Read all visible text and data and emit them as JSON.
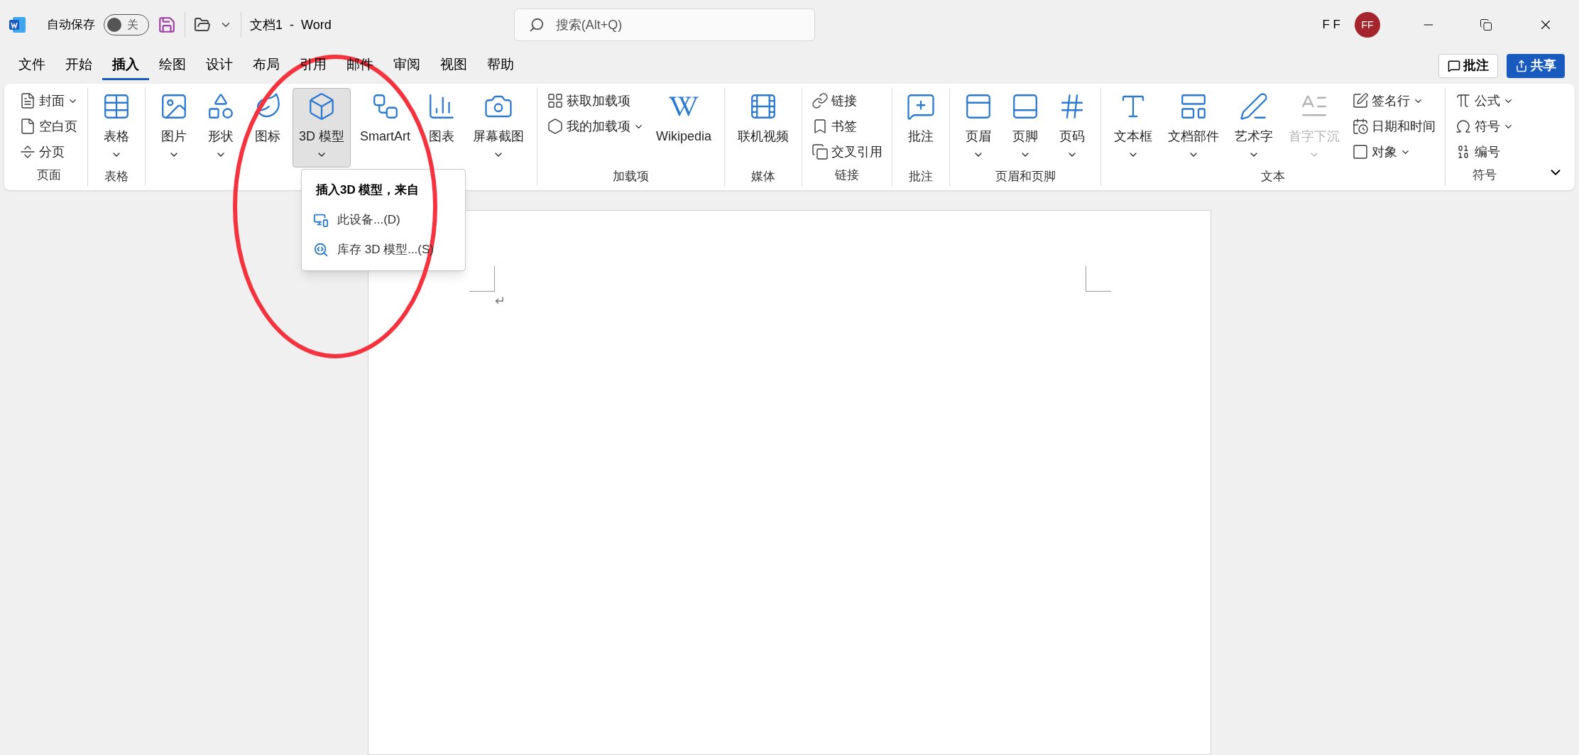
{
  "title_bar": {
    "autosave_label": "自动保存",
    "autosave_toggle": {
      "on": false,
      "label": "关"
    },
    "title": "文档1  -  Word",
    "search": {
      "placeholder": "搜索(Alt+Q)"
    },
    "user_name": "F F",
    "avatar": "FF"
  },
  "menu_tabs": [
    {
      "label": "文件",
      "selected": false
    },
    {
      "label": "开始",
      "selected": false
    },
    {
      "label": "插入",
      "selected": true
    },
    {
      "label": "绘图",
      "selected": false
    },
    {
      "label": "设计",
      "selected": false
    },
    {
      "label": "布局",
      "selected": false
    },
    {
      "label": "引用",
      "selected": false
    },
    {
      "label": "邮件",
      "selected": false
    },
    {
      "label": "审阅",
      "selected": false
    },
    {
      "label": "视图",
      "selected": false
    },
    {
      "label": "帮助",
      "selected": false
    }
  ],
  "comments_button": "批注",
  "share_button": "共享",
  "ribbon_groups": [
    {
      "label": "页面",
      "items": [
        {
          "label": "封面",
          "kind": "small",
          "dropdown": true,
          "disabled": false,
          "expanded": false
        },
        {
          "label": "空白页",
          "kind": "small",
          "dropdown": false,
          "disabled": false,
          "expanded": false
        },
        {
          "label": "分页",
          "kind": "small",
          "dropdown": false,
          "disabled": false,
          "expanded": false
        }
      ]
    },
    {
      "label": "表格",
      "items": [
        {
          "label": "表格",
          "kind": "large",
          "dropdown": true,
          "disabled": false,
          "expanded": false
        }
      ]
    },
    {
      "items": [
        {
          "label": "图片",
          "kind": "large",
          "dropdown": true,
          "disabled": false,
          "expanded": false
        },
        {
          "label": "形状",
          "kind": "large",
          "dropdown": true,
          "disabled": false,
          "expanded": false
        },
        {
          "label": "图标",
          "kind": "large",
          "dropdown": false,
          "disabled": false,
          "expanded": false
        },
        {
          "label": "3D 模型",
          "kind": "large",
          "dropdown": true,
          "disabled": false,
          "expanded": true
        },
        {
          "label": "SmartArt",
          "kind": "large",
          "dropdown": false,
          "disabled": false,
          "expanded": false
        },
        {
          "label": "图表",
          "kind": "large",
          "dropdown": false,
          "disabled": false,
          "expanded": false
        },
        {
          "label": "屏幕截图",
          "kind": "large",
          "dropdown": true,
          "disabled": false,
          "expanded": false
        }
      ]
    },
    {
      "label": "加载项",
      "items": [
        {
          "label": "获取加载项",
          "kind": "small",
          "dropdown": false,
          "disabled": false,
          "expanded": false
        },
        {
          "label": "我的加载项",
          "kind": "small",
          "dropdown": true,
          "disabled": false,
          "expanded": false
        },
        {
          "label": "Wikipedia",
          "kind": "large",
          "dropdown": false,
          "disabled": false,
          "expanded": false
        }
      ]
    },
    {
      "label": "媒体",
      "items": [
        {
          "label": "联机视频",
          "kind": "large",
          "dropdown": false,
          "disabled": false,
          "expanded": false
        }
      ]
    },
    {
      "label": "链接",
      "items": [
        {
          "label": "链接",
          "kind": "small",
          "dropdown": false,
          "disabled": false,
          "expanded": false
        },
        {
          "label": "书签",
          "kind": "small",
          "dropdown": false,
          "disabled": false,
          "expanded": false
        },
        {
          "label": "交叉引用",
          "kind": "small",
          "dropdown": false,
          "disabled": false,
          "expanded": false
        }
      ]
    },
    {
      "label": "批注",
      "items": [
        {
          "label": "批注",
          "kind": "large",
          "dropdown": false,
          "disabled": false,
          "expanded": false
        }
      ]
    },
    {
      "label": "页眉和页脚",
      "items": [
        {
          "label": "页眉",
          "kind": "large",
          "dropdown": true,
          "disabled": false,
          "expanded": false
        },
        {
          "label": "页脚",
          "kind": "large",
          "dropdown": true,
          "disabled": false,
          "expanded": false
        },
        {
          "label": "页码",
          "kind": "large",
          "dropdown": true,
          "disabled": false,
          "expanded": false
        }
      ]
    },
    {
      "label": "文本",
      "items": [
        {
          "label": "文本框",
          "kind": "large",
          "dropdown": true,
          "disabled": false,
          "expanded": false
        },
        {
          "label": "文档部件",
          "kind": "large",
          "dropdown": true,
          "disabled": false,
          "expanded": false
        },
        {
          "label": "艺术字",
          "kind": "large",
          "dropdown": true,
          "disabled": false,
          "expanded": false
        },
        {
          "label": "首字下沉",
          "kind": "large",
          "dropdown": true,
          "disabled": true,
          "expanded": false
        },
        {
          "label": "签名行",
          "kind": "small",
          "dropdown": true,
          "disabled": false,
          "expanded": false
        },
        {
          "label": "日期和时间",
          "kind": "small",
          "dropdown": false,
          "disabled": false,
          "expanded": false
        },
        {
          "label": "对象",
          "kind": "small",
          "dropdown": true,
          "disabled": false,
          "expanded": false
        }
      ]
    },
    {
      "label": "符号",
      "items": [
        {
          "label": "公式",
          "kind": "small",
          "dropdown": true,
          "disabled": false,
          "expanded": false
        },
        {
          "label": "符号",
          "kind": "small",
          "dropdown": true,
          "disabled": false,
          "expanded": false
        },
        {
          "label": "编号",
          "kind": "small",
          "dropdown": false,
          "disabled": false,
          "expanded": false
        }
      ]
    }
  ],
  "dropdown_menu": {
    "header": "插入3D 模型，来自",
    "items": [
      "此设备...(D)",
      "库存 3D 模型...(S)"
    ]
  },
  "document": {
    "paragraph_mark": "↵"
  }
}
